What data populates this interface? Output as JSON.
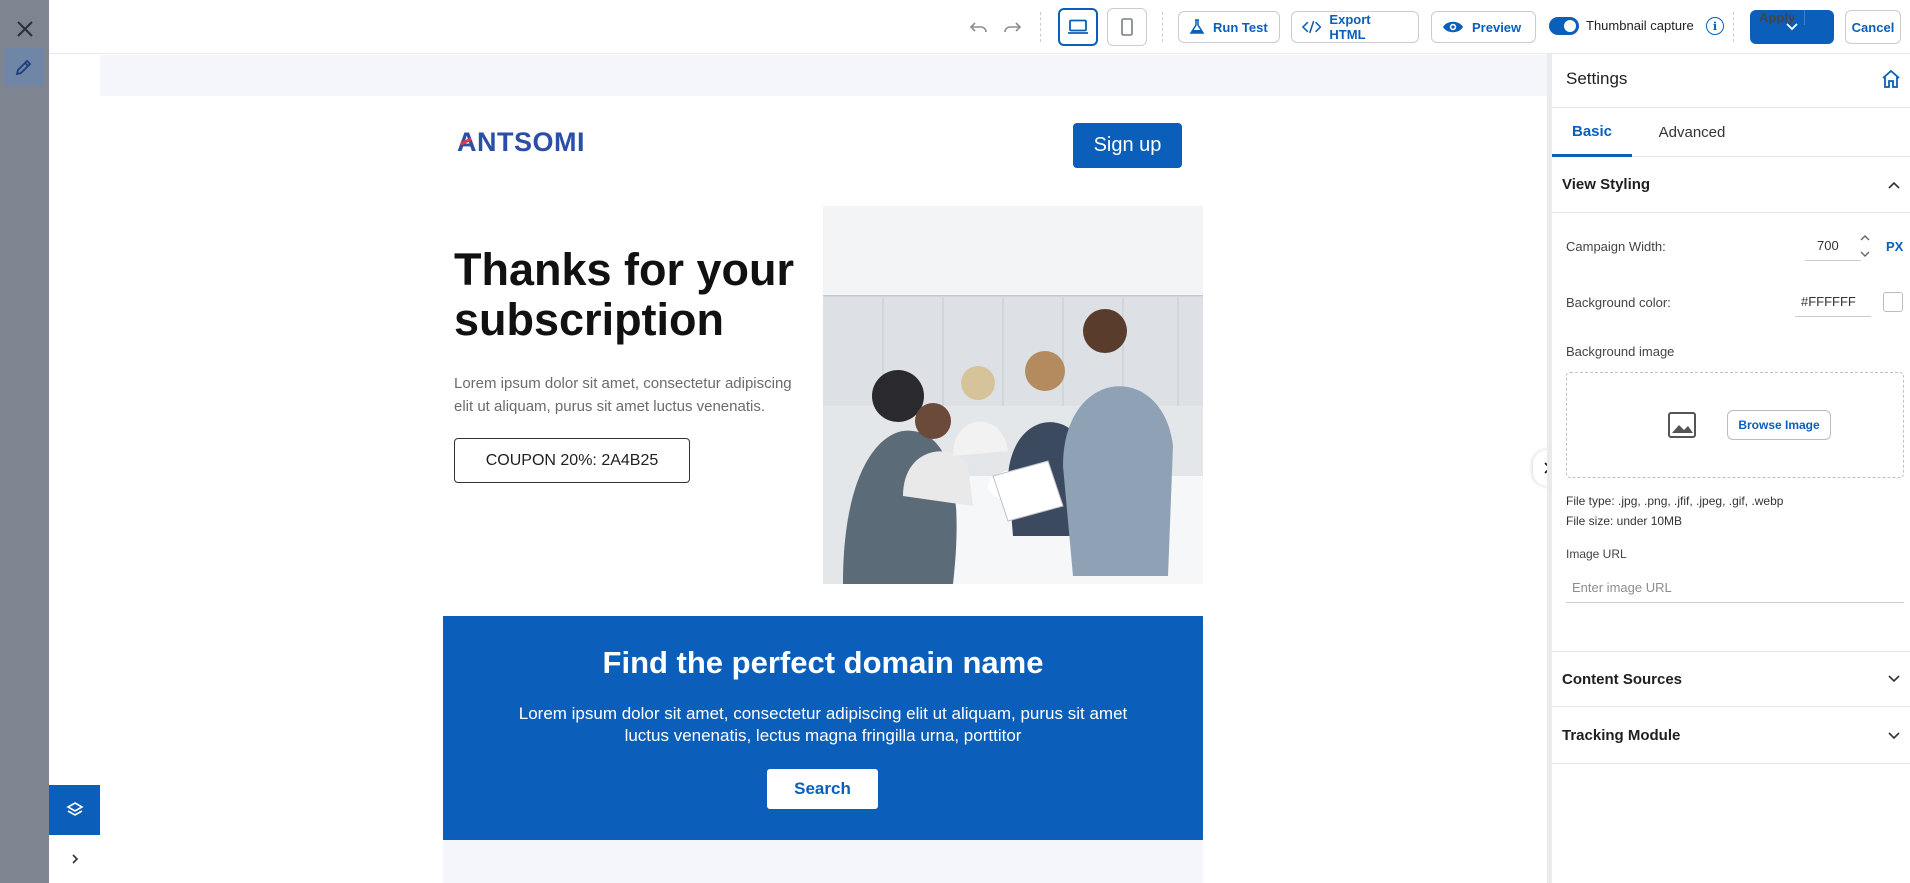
{
  "toolbar": {
    "run_test_label": "Run Test",
    "export_html_label": "Export HTML",
    "preview_label": "Preview",
    "thumbnail_label": "Thumbnail capture",
    "apply_label": "Apply",
    "cancel_label": "Cancel",
    "thumbnail_enabled": true,
    "active_device": "desktop"
  },
  "email": {
    "logo_text": "ANTSOMI",
    "signup_label": "Sign up",
    "hero_title": "Thanks for your subscription",
    "hero_text": "Lorem ipsum dolor sit amet, consectetur adipiscing elit ut aliquam, purus sit amet luctus venenatis.",
    "coupon_text": "COUPON 20%: 2A4B25",
    "banner_title": "Find the perfect domain name",
    "banner_text": "Lorem ipsum dolor sit amet, consectetur adipiscing elit ut aliquam, purus sit amet luctus venenatis, lectus magna fringilla urna, porttitor",
    "banner_button": "Search"
  },
  "panel": {
    "title": "Settings",
    "tabs": [
      {
        "label": "Basic",
        "active": true
      },
      {
        "label": "Advanced",
        "active": false
      }
    ],
    "view_styling": {
      "title": "View Styling",
      "campaign_width_label": "Campaign Width:",
      "campaign_width_value": "700",
      "unit": "PX",
      "bg_color_label": "Background color:",
      "bg_color_value": "#FFFFFF",
      "bg_image_label": "Background image",
      "browse_label": "Browse Image",
      "file_type": "File type: .jpg, .png, .jfif, .jpeg, .gif, .webp",
      "file_size": "File size: under 10MB",
      "image_url_label": "Image URL",
      "image_url_placeholder": "Enter image URL"
    },
    "content_sources_title": "Content Sources",
    "tracking_module_title": "Tracking Module"
  },
  "colors": {
    "accent": "#0b5fba",
    "strip": "#7e8490"
  }
}
